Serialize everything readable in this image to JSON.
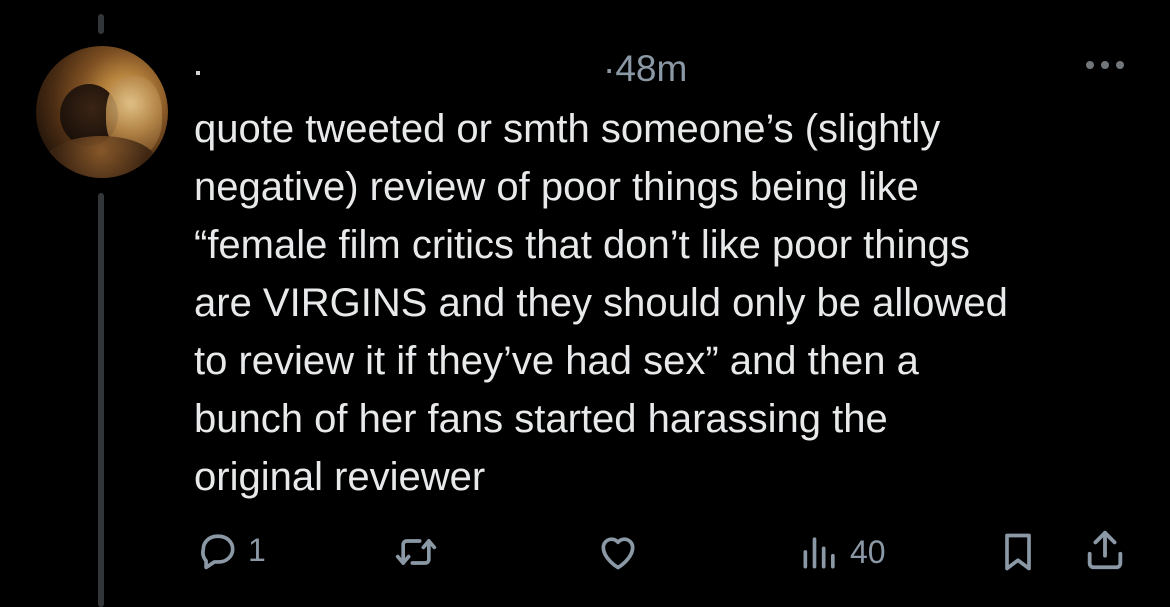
{
  "tweet": {
    "author_name": "",
    "timestamp": "·48m",
    "text_lines": [
      "quote tweeted or smth someone’s (slightly",
      "negative) review of poor things being like",
      "“female film critics that don’t like poor things",
      "are VIRGINS and they should only be allowed",
      "to review it if they’ve had sex” and then a",
      "bunch of her fans started harassing the",
      "original reviewer"
    ]
  },
  "actions": {
    "reply_count": "1",
    "retweet_count": "",
    "like_count": "",
    "views_count": "40"
  },
  "icons": {
    "reply": "reply-icon",
    "retweet": "retweet-icon",
    "like": "heart-icon",
    "views": "views-icon",
    "bookmark": "bookmark-icon",
    "share": "share-icon",
    "more": "more-icon"
  },
  "colors": {
    "background": "#000000",
    "text": "#e7e9ea",
    "secondary": "#8b98a5",
    "thread_line": "#333639"
  }
}
